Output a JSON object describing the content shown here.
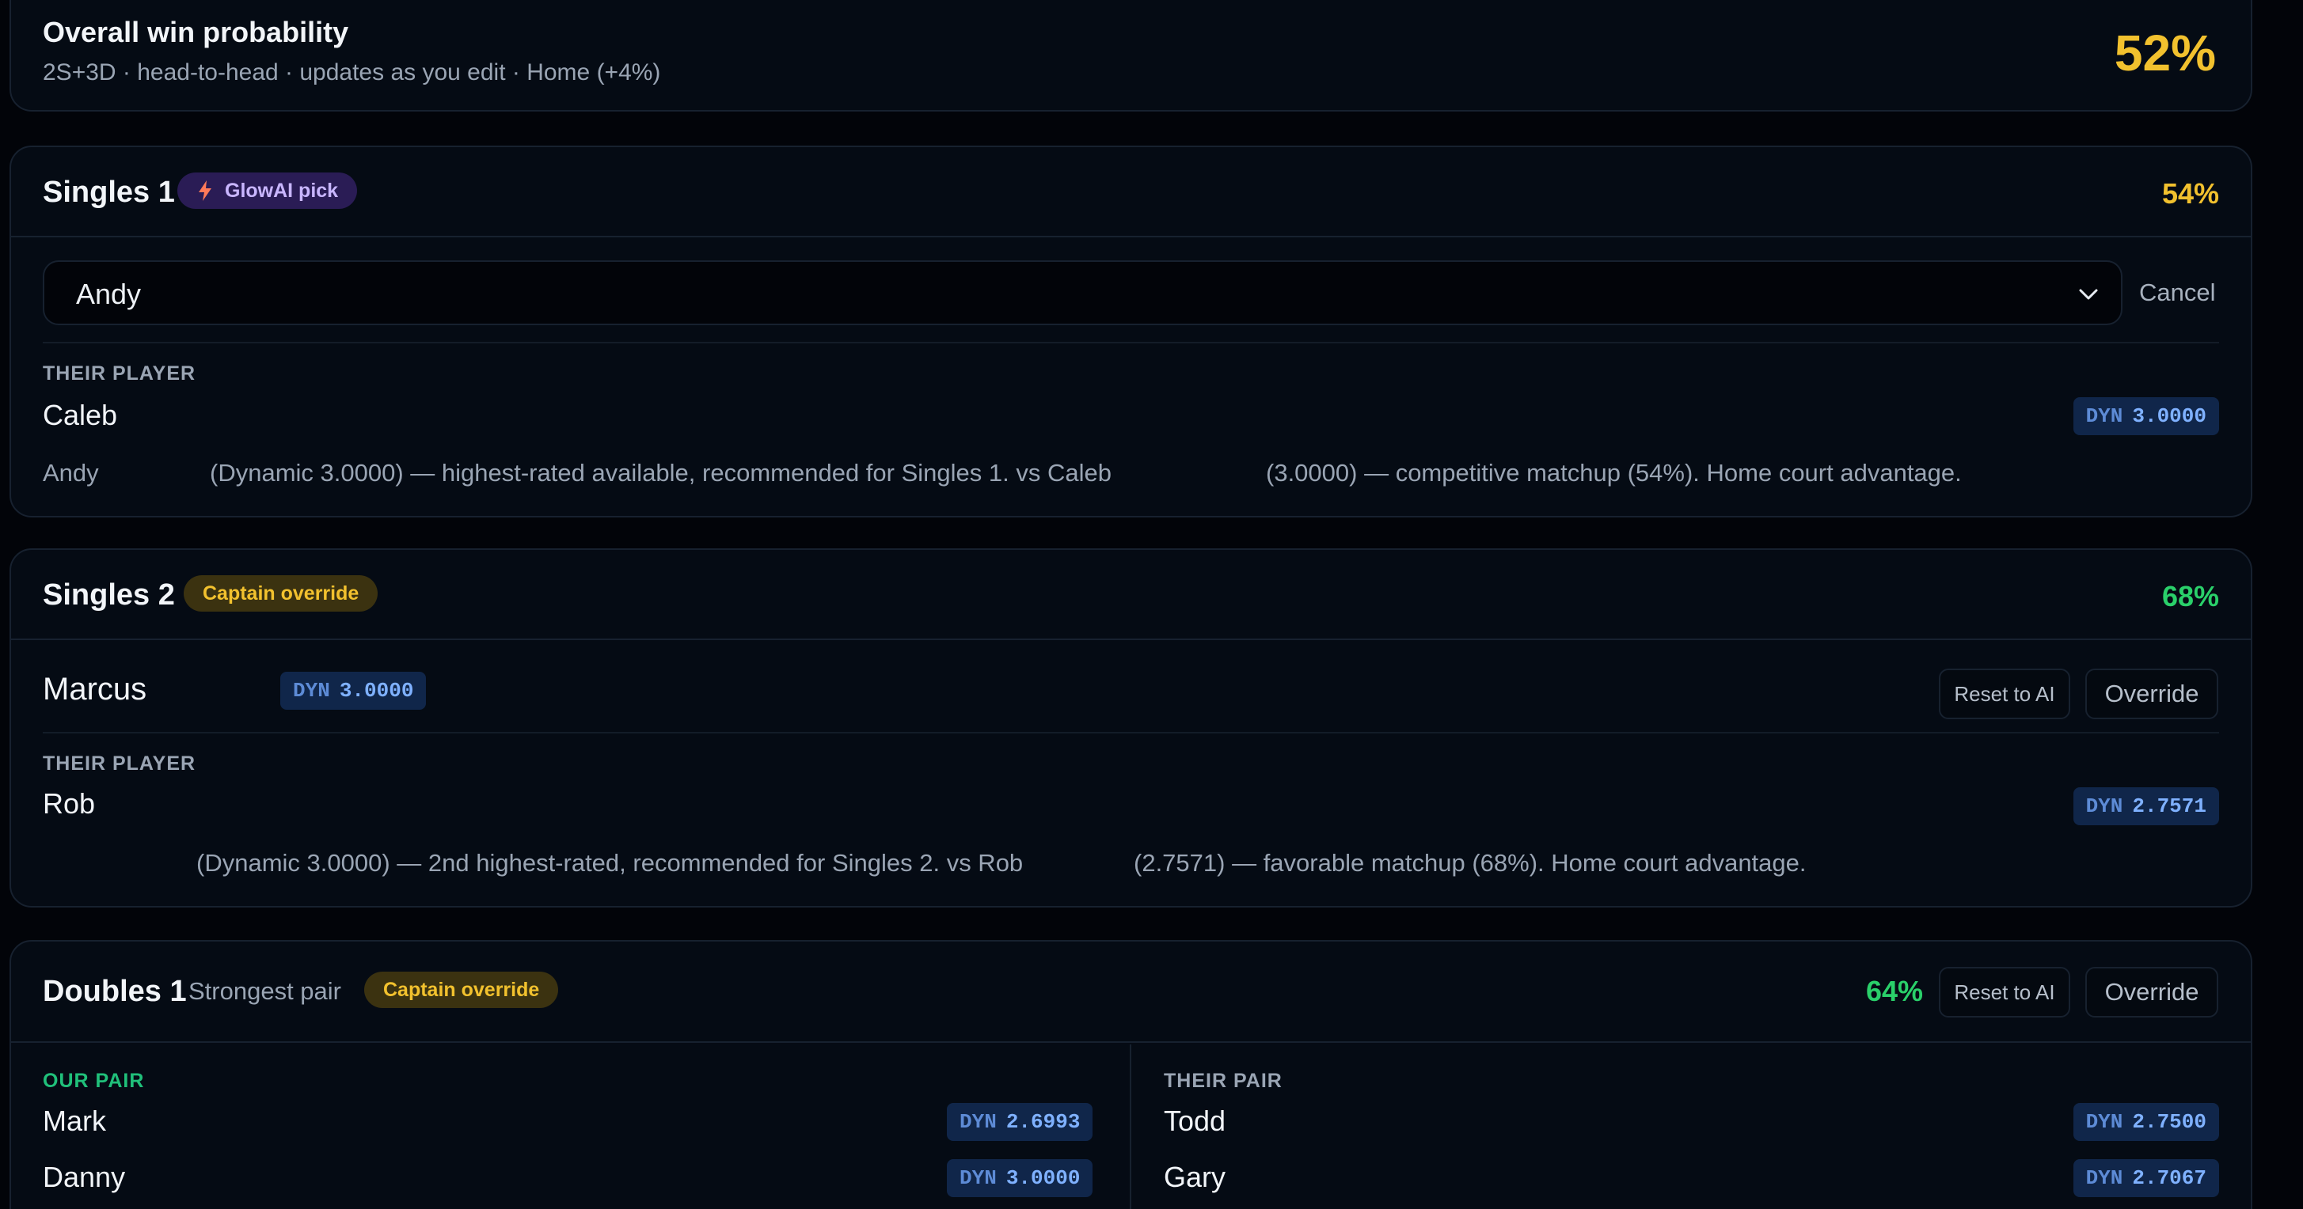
{
  "overall": {
    "title": "Overall win probability",
    "subtitle": "2S+3D · head-to-head · updates as you edit · Home (+4%)",
    "percent": "52%"
  },
  "singles1": {
    "title": "Singles 1",
    "badge": "GlowAI pick",
    "percent": "54%",
    "select_value": "Andy",
    "cancel_label": "Cancel",
    "their_label": "THEIR PLAYER",
    "their_player": "Caleb",
    "their_dyn_key": "DYN",
    "their_dyn_val": "3.0000",
    "desc_name": "Andy",
    "desc_mid": "(Dynamic 3.0000) — highest-rated available, recommended for Singles 1. vs Caleb",
    "desc_end": "(3.0000) — competitive matchup (54%). Home court advantage."
  },
  "singles2": {
    "title": "Singles 2",
    "badge": "Captain override",
    "percent": "68%",
    "our_player": "Marcus",
    "our_dyn_key": "DYN",
    "our_dyn_val": "3.0000",
    "reset_label": "Reset to AI",
    "override_label": "Override",
    "their_label": "THEIR PLAYER",
    "their_player": "Rob",
    "their_dyn_key": "DYN",
    "their_dyn_val": "2.7571",
    "desc_mid": "(Dynamic 3.0000) — 2nd highest-rated, recommended for Singles 2. vs Rob",
    "desc_end": "(2.7571) — favorable matchup (68%). Home court advantage."
  },
  "doubles1": {
    "title": "Doubles 1",
    "subtitle": "Strongest pair",
    "badge": "Captain override",
    "percent": "64%",
    "reset_label": "Reset to AI",
    "override_label": "Override",
    "our_label": "OUR PAIR",
    "their_label": "THEIR PAIR",
    "our_players": [
      {
        "name": "Mark",
        "dyn_key": "DYN",
        "dyn_val": "2.6993"
      },
      {
        "name": "Danny",
        "dyn_key": "DYN",
        "dyn_val": "3.0000"
      }
    ],
    "their_players": [
      {
        "name": "Todd",
        "dyn_key": "DYN",
        "dyn_val": "2.7500"
      },
      {
        "name": "Gary",
        "dyn_key": "DYN",
        "dyn_val": "2.7067"
      }
    ]
  },
  "colors": {
    "accent_yellow": "#f2c12e",
    "accent_green": "#2ad06a",
    "ai_purple": "#c9b6ff",
    "dyn_blue": "#7fb1ff"
  }
}
